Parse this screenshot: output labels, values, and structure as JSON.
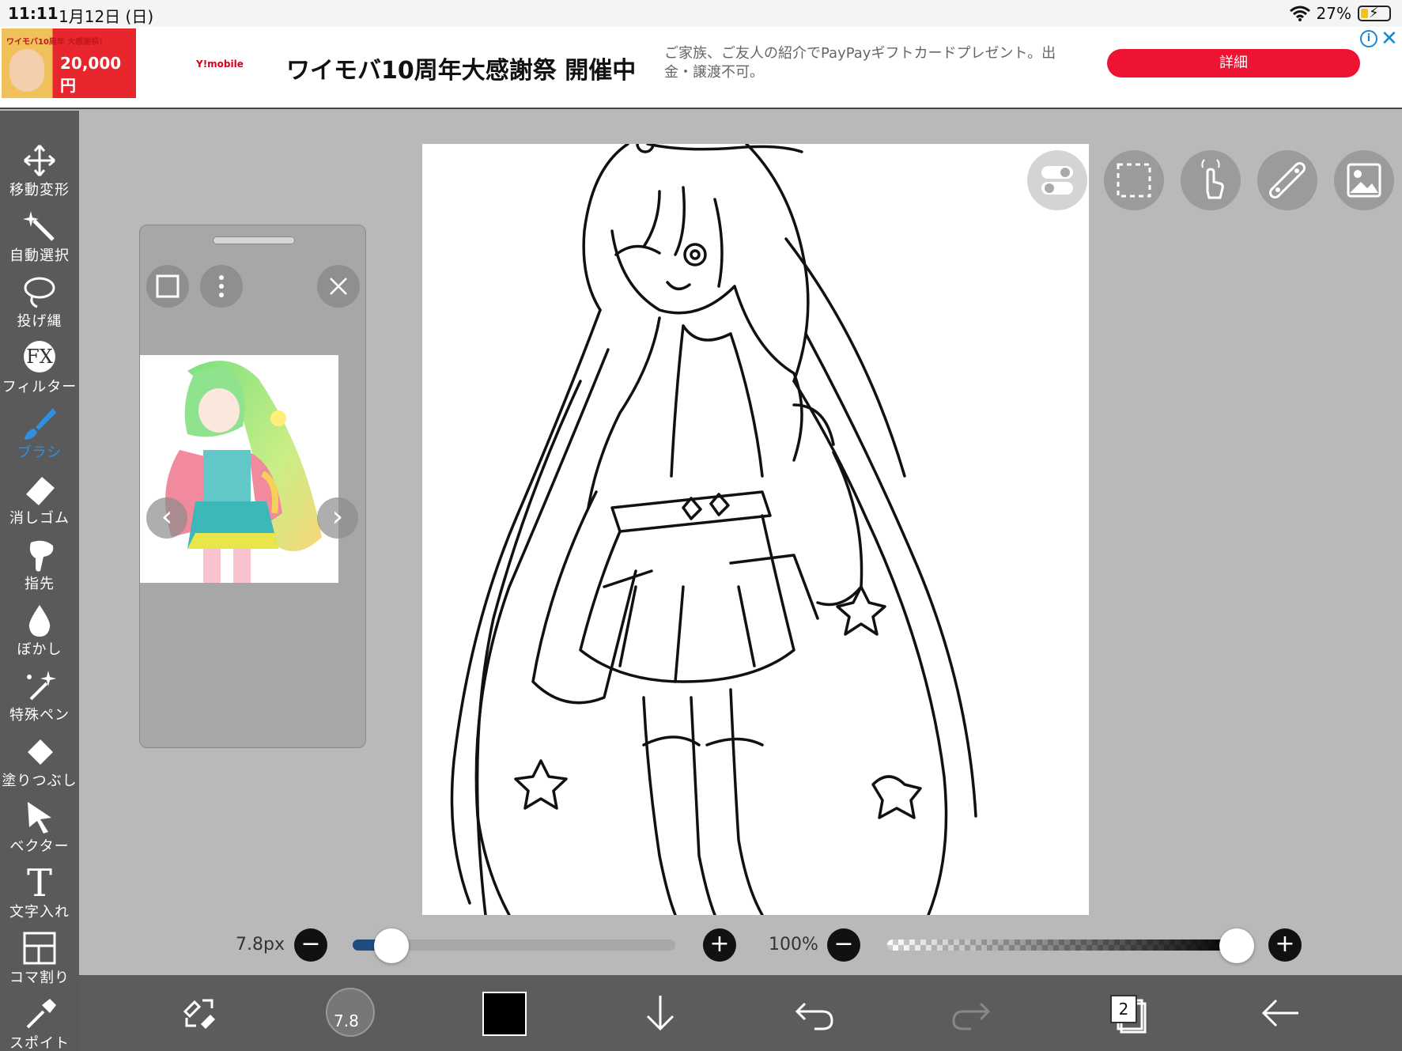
{
  "status": {
    "time": "11:11",
    "date": "1月12日 (日)",
    "battery": "27%",
    "battery_level": 0.27
  },
  "ad": {
    "thumb_small": "ワイモバ10周年 大感謝祭!",
    "thumb_price": "20,000円",
    "brand": "Y!mobile",
    "title": "ワイモバ10周年大感謝祭 開催中",
    "description": "ご家族、ご友人の紹介でPayPayギフトカードプレゼント。出金・譲渡不可。",
    "button": "詳細"
  },
  "tools": [
    {
      "id": "move",
      "label": "移動変形",
      "icon": "move-arrows-icon"
    },
    {
      "id": "magic",
      "label": "自動選択",
      "icon": "magic-wand-icon"
    },
    {
      "id": "lasso",
      "label": "投げ縄",
      "icon": "lasso-icon"
    },
    {
      "id": "filter",
      "label": "フィルター",
      "icon": "fx-icon",
      "badge": "FX"
    },
    {
      "id": "brush",
      "label": "ブラシ",
      "icon": "brush-icon",
      "active": true
    },
    {
      "id": "eraser",
      "label": "消しゴム",
      "icon": "eraser-icon"
    },
    {
      "id": "finger",
      "label": "指先",
      "icon": "finger-icon"
    },
    {
      "id": "blur",
      "label": "ぼかし",
      "icon": "blur-drop-icon"
    },
    {
      "id": "special",
      "label": "特殊ペン",
      "icon": "special-pen-icon"
    },
    {
      "id": "fill",
      "label": "塗りつぶし",
      "icon": "fill-bucket-icon"
    },
    {
      "id": "vector",
      "label": "ベクター",
      "icon": "vector-cursor-icon"
    },
    {
      "id": "text",
      "label": "文字入れ",
      "icon": "text-icon",
      "badge": "T"
    },
    {
      "id": "frame",
      "label": "コマ割り",
      "icon": "frame-divide-icon"
    },
    {
      "id": "eyedropper",
      "label": "スポイト",
      "icon": "eyedropper-icon"
    }
  ],
  "brush": {
    "size_label": "7.8px",
    "size_fraction": 0.12,
    "opacity_label": "100%",
    "opacity_fraction": 1.0,
    "preview_size": "7.8"
  },
  "layers": {
    "count": "2"
  },
  "colors": {
    "accent": "#2f8fe2",
    "ad_button": "#ee1233",
    "current_color": "#000000"
  }
}
